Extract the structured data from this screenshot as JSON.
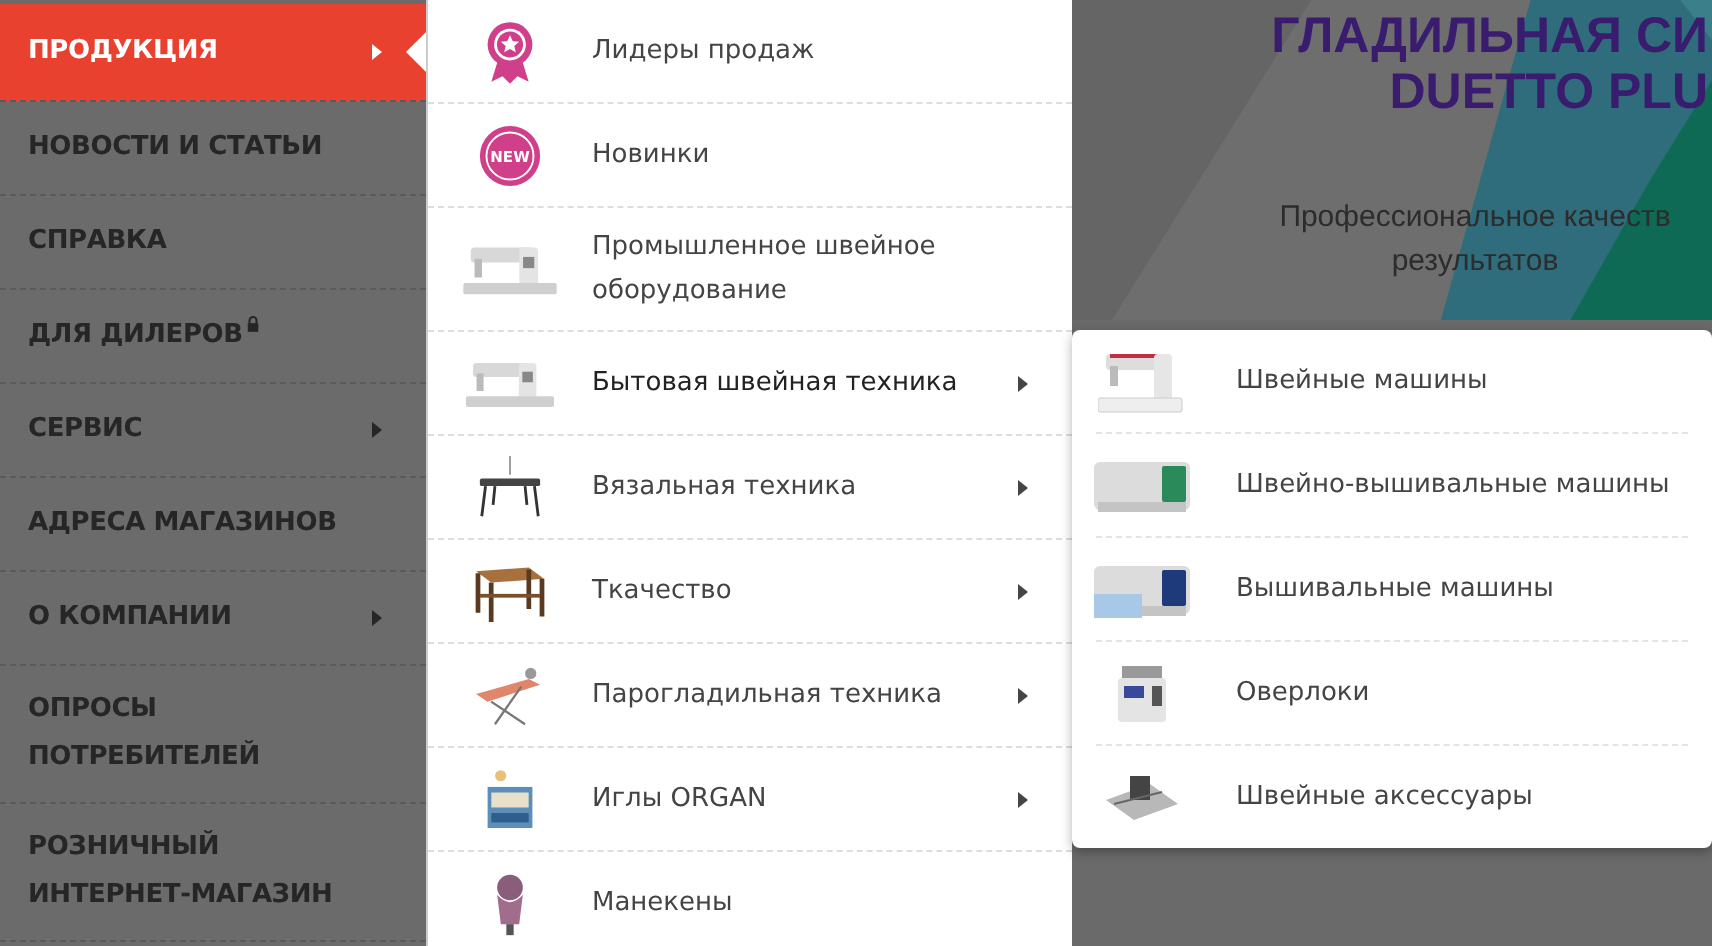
{
  "nav": {
    "items": [
      {
        "label": "ПРОДУКЦИЯ",
        "selected": true,
        "has_submenu": true,
        "locked": false
      },
      {
        "label": "НОВОСТИ И СТАТЬИ",
        "selected": false,
        "has_submenu": false,
        "locked": false
      },
      {
        "label": "СПРАВКА",
        "selected": false,
        "has_submenu": false,
        "locked": false
      },
      {
        "label": "ДЛЯ ДИЛЕРОВ",
        "selected": false,
        "has_submenu": false,
        "locked": true
      },
      {
        "label": "СЕРВИС",
        "selected": false,
        "has_submenu": true,
        "locked": false
      },
      {
        "label": "АДРЕСА МАГАЗИНОВ",
        "selected": false,
        "has_submenu": false,
        "locked": false
      },
      {
        "label": "О КОМПАНИИ",
        "selected": false,
        "has_submenu": true,
        "locked": false
      },
      {
        "label": "ОПРОСЫ ПОТРЕБИТЕЛЕЙ",
        "selected": false,
        "has_submenu": false,
        "locked": false
      },
      {
        "label": "РОЗНИЧНЫЙ ИНТЕРНЕТ-МАГАЗИН",
        "selected": false,
        "has_submenu": false,
        "locked": false
      }
    ]
  },
  "catalog_menu": {
    "items": [
      {
        "label": "Лидеры продаж",
        "has_submenu": false,
        "expanded": false
      },
      {
        "label": "Новинки",
        "icon_text": "NEW",
        "has_submenu": false,
        "expanded": false
      },
      {
        "label": "Промышленное швейное оборудование",
        "has_submenu": false,
        "expanded": false
      },
      {
        "label": "Бытовая швейная техника",
        "has_submenu": true,
        "expanded": true
      },
      {
        "label": "Вязальная техника",
        "has_submenu": true,
        "expanded": false
      },
      {
        "label": "Ткачество",
        "has_submenu": true,
        "expanded": false
      },
      {
        "label": "Парогладильная техника",
        "has_submenu": true,
        "expanded": false
      },
      {
        "label": "Иглы ORGAN",
        "has_submenu": true,
        "expanded": false
      },
      {
        "label": "Манекены",
        "has_submenu": false,
        "expanded": false
      }
    ]
  },
  "submenu": {
    "items": [
      {
        "label": "Швейные машины"
      },
      {
        "label": "Швейно-вышивальные машины"
      },
      {
        "label": "Вышивальные машины"
      },
      {
        "label": "Оверлоки"
      },
      {
        "label": "Швейные аксессуары"
      }
    ]
  },
  "banner": {
    "title_lines": [
      "ГЛАДИЛЬНАЯ СИ",
      "DUETTO PLU"
    ],
    "subtitle_lines": [
      "Профессиональное качеств",
      "результатов"
    ]
  }
}
